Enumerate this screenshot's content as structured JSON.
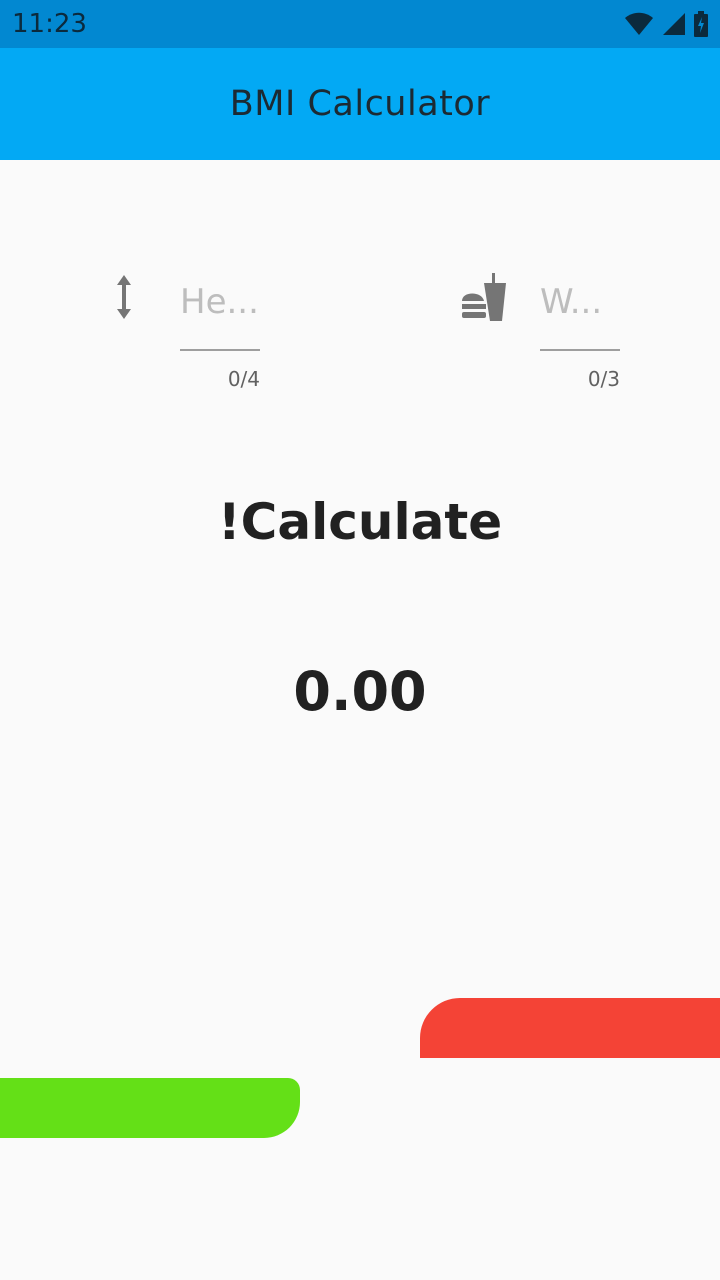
{
  "status_bar": {
    "time": "11:23",
    "icons": [
      "wifi-icon",
      "signal-icon",
      "battery-icon"
    ]
  },
  "app_bar": {
    "title": "BMI Calculator",
    "color": "#03a9f4"
  },
  "height_field": {
    "placeholder": "He...",
    "value": "",
    "counter": "0/4",
    "icon": "height-arrow-icon"
  },
  "weight_field": {
    "placeholder": "W...",
    "value": "",
    "counter": "0/3",
    "icon": "fastfood-icon"
  },
  "calculate_button": {
    "label": "!Calculate"
  },
  "result": {
    "value": "0.00"
  },
  "bars": {
    "red_color": "#f44336",
    "green_color": "#64e017"
  }
}
